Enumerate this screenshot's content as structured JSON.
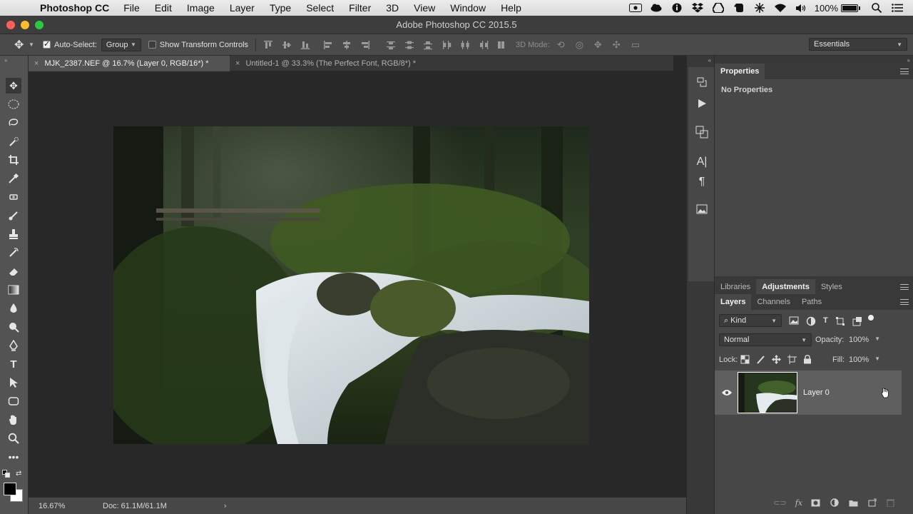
{
  "menubar": {
    "app_name": "Photoshop CC",
    "menus": [
      "File",
      "Edit",
      "Image",
      "Layer",
      "Type",
      "Select",
      "Filter",
      "3D",
      "View",
      "Window",
      "Help"
    ],
    "battery": "100%"
  },
  "window": {
    "title": "Adobe Photoshop CC 2015.5"
  },
  "options": {
    "auto_select_label": "Auto-Select:",
    "auto_select_value": "Group",
    "show_transform_label": "Show Transform Controls",
    "mode_3d_label": "3D Mode:",
    "workspace": "Essentials"
  },
  "tabs": [
    {
      "label": "MJK_2387.NEF @ 16.7% (Layer 0, RGB/16*) *",
      "active": true
    },
    {
      "label": "Untitled-1 @ 33.3% (The  Perfect Font, RGB/8*) *",
      "active": false
    }
  ],
  "status": {
    "zoom": "16.67%",
    "doc": "Doc: 61.1M/61.1M"
  },
  "properties": {
    "title": "Properties",
    "body": "No Properties"
  },
  "mid_panel": {
    "tabs": [
      "Libraries",
      "Adjustments",
      "Styles"
    ],
    "active": "Adjustments"
  },
  "layers_panel": {
    "tabs": [
      "Layers",
      "Channels",
      "Paths"
    ],
    "active": "Layers",
    "filter_kind": "Kind",
    "blend_mode": "Normal",
    "opacity_label": "Opacity:",
    "opacity_value": "100%",
    "lock_label": "Lock:",
    "fill_label": "Fill:",
    "fill_value": "100%",
    "layers": [
      {
        "name": "Layer 0"
      }
    ]
  },
  "colors": {
    "accent_fg": "#000000",
    "accent_bg": "#ffffff"
  }
}
